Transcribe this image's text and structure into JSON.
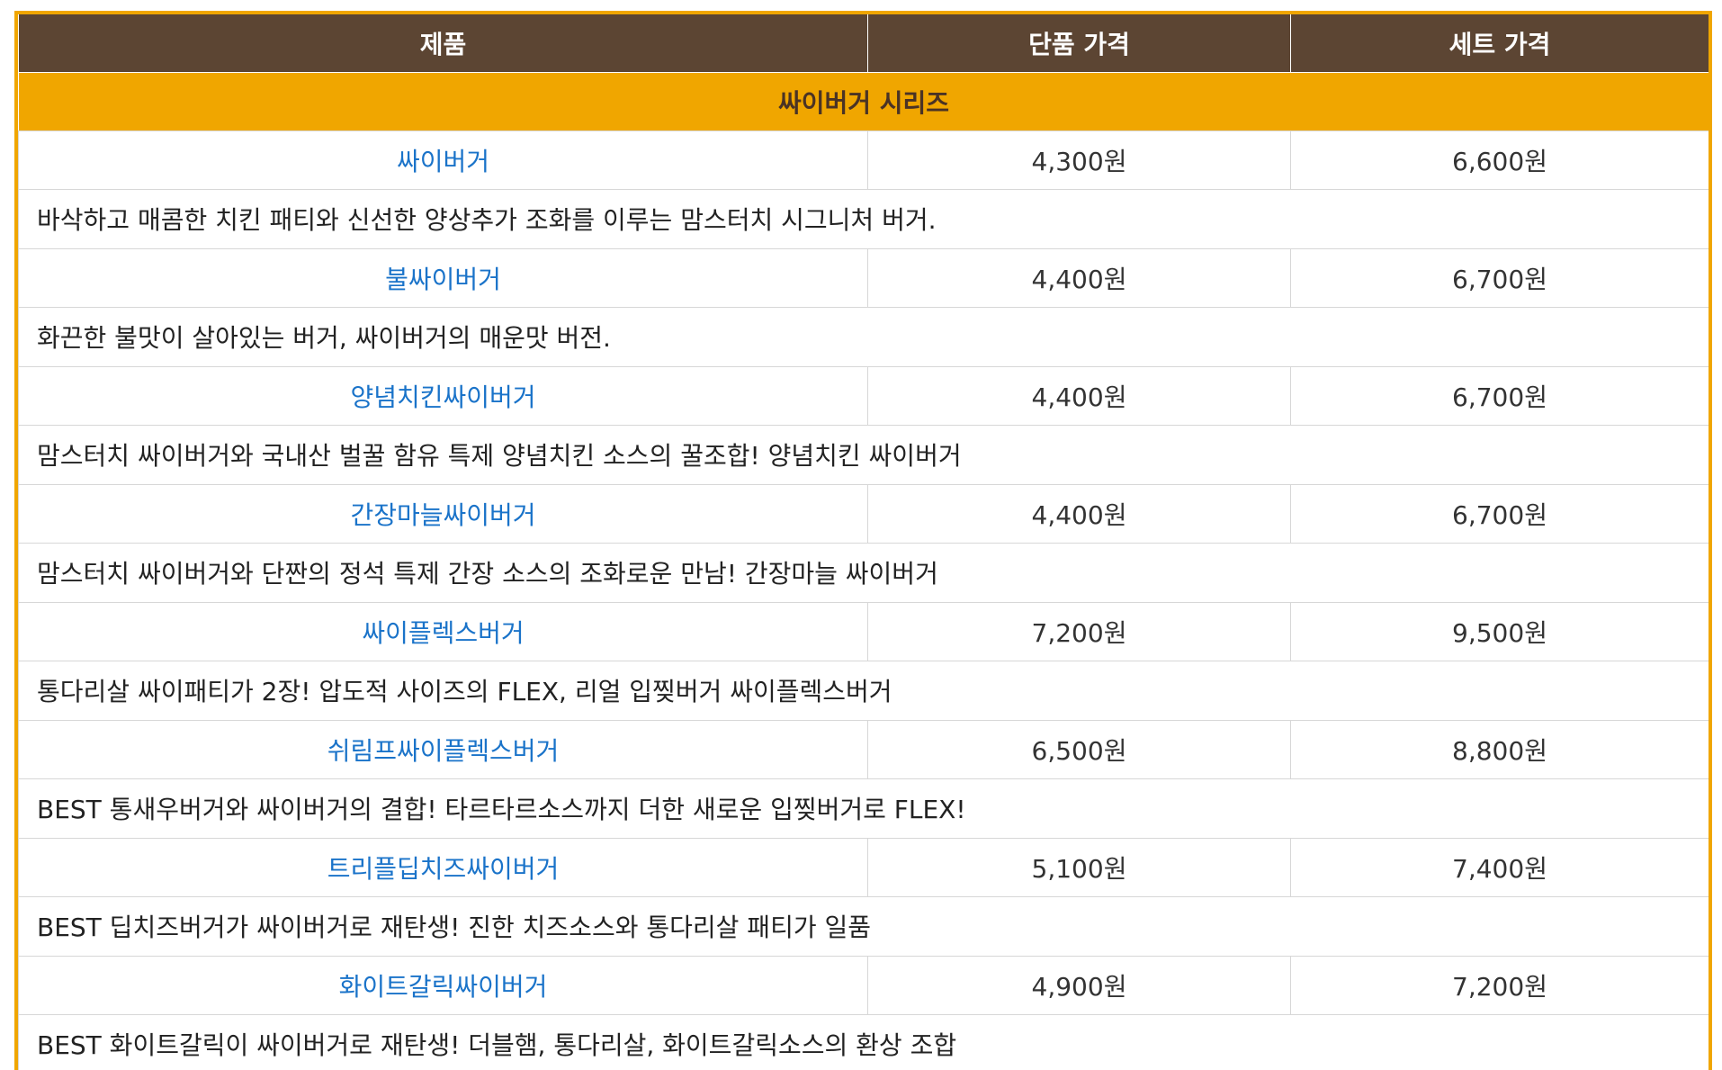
{
  "header": {
    "product": "제품",
    "single_price": "단품 가격",
    "set_price": "세트 가격"
  },
  "category": "싸이버거 시리즈",
  "items": [
    {
      "name": "싸이버거",
      "single": "4,300원",
      "set": "6,600원",
      "desc": "바삭하고 매콤한 치킨 패티와 신선한 양상추가 조화를 이루는 맘스터치 시그니처 버거."
    },
    {
      "name": "불싸이버거",
      "single": "4,400원",
      "set": "6,700원",
      "desc": "화끈한 불맛이 살아있는 버거, 싸이버거의 매운맛 버전."
    },
    {
      "name": "양념치킨싸이버거",
      "single": "4,400원",
      "set": "6,700원",
      "desc": "맘스터치 싸이버거와 국내산 벌꿀 함유 특제 양념치킨 소스의 꿀조합! 양념치킨 싸이버거"
    },
    {
      "name": "간장마늘싸이버거",
      "single": "4,400원",
      "set": "6,700원",
      "desc": "맘스터치 싸이버거와 단짠의 정석 특제 간장 소스의 조화로운 만남! 간장마늘 싸이버거"
    },
    {
      "name": "싸이플렉스버거",
      "single": "7,200원",
      "set": "9,500원",
      "desc": "통다리살 싸이패티가 2장! 압도적 사이즈의 FLEX, 리얼 입찢버거 싸이플렉스버거"
    },
    {
      "name": "쉬림프싸이플렉스버거",
      "single": "6,500원",
      "set": "8,800원",
      "desc": "BEST 통새우버거와 싸이버거의 결합! 타르타르소스까지 더한 새로운 입찢버거로 FLEX!"
    },
    {
      "name": "트리플딥치즈싸이버거",
      "single": "5,100원",
      "set": "7,400원",
      "desc": "BEST 딥치즈버거가 싸이버거로 재탄생! 진한 치즈소스와 통다리살 패티가 일품"
    },
    {
      "name": "화이트갈릭싸이버거",
      "single": "4,900원",
      "set": "7,200원",
      "desc": "BEST 화이트갈릭이 싸이버거로 재탄생! 더블햄, 통다리살, 화이트갈릭소스의 환상 조합"
    }
  ],
  "colors": {
    "header_bg": "#5c4533",
    "category_bg": "#f0a600",
    "link": "#1a73c9"
  }
}
